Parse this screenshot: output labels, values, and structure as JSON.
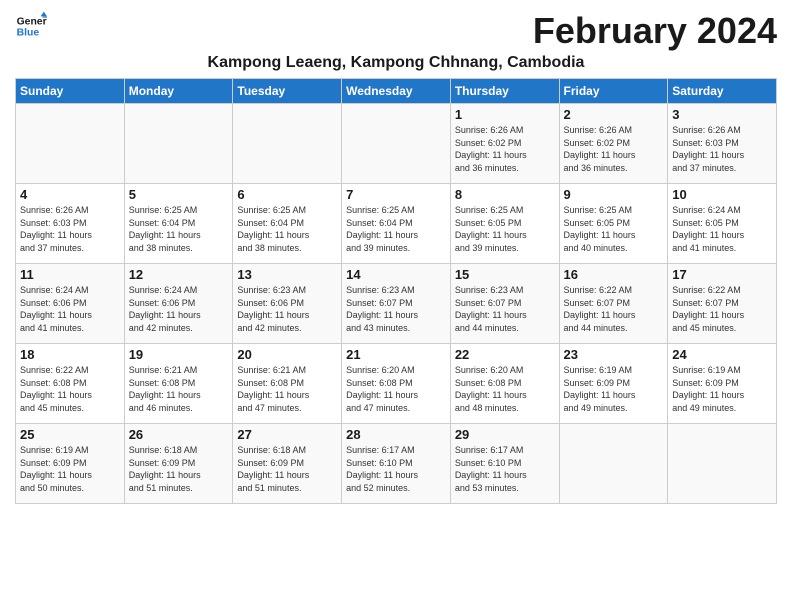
{
  "app": {
    "name": "GeneralBlue",
    "logo_text_line1": "General",
    "logo_text_line2": "Blue"
  },
  "calendar": {
    "month_year": "February 2024",
    "location": "Kampong Leaeng, Kampong Chhnang, Cambodia",
    "days_of_week": [
      "Sunday",
      "Monday",
      "Tuesday",
      "Wednesday",
      "Thursday",
      "Friday",
      "Saturday"
    ],
    "weeks": [
      [
        {
          "day": "",
          "info": ""
        },
        {
          "day": "",
          "info": ""
        },
        {
          "day": "",
          "info": ""
        },
        {
          "day": "",
          "info": ""
        },
        {
          "day": "1",
          "info": "Sunrise: 6:26 AM\nSunset: 6:02 PM\nDaylight: 11 hours\nand 36 minutes."
        },
        {
          "day": "2",
          "info": "Sunrise: 6:26 AM\nSunset: 6:02 PM\nDaylight: 11 hours\nand 36 minutes."
        },
        {
          "day": "3",
          "info": "Sunrise: 6:26 AM\nSunset: 6:03 PM\nDaylight: 11 hours\nand 37 minutes."
        }
      ],
      [
        {
          "day": "4",
          "info": "Sunrise: 6:26 AM\nSunset: 6:03 PM\nDaylight: 11 hours\nand 37 minutes."
        },
        {
          "day": "5",
          "info": "Sunrise: 6:25 AM\nSunset: 6:04 PM\nDaylight: 11 hours\nand 38 minutes."
        },
        {
          "day": "6",
          "info": "Sunrise: 6:25 AM\nSunset: 6:04 PM\nDaylight: 11 hours\nand 38 minutes."
        },
        {
          "day": "7",
          "info": "Sunrise: 6:25 AM\nSunset: 6:04 PM\nDaylight: 11 hours\nand 39 minutes."
        },
        {
          "day": "8",
          "info": "Sunrise: 6:25 AM\nSunset: 6:05 PM\nDaylight: 11 hours\nand 39 minutes."
        },
        {
          "day": "9",
          "info": "Sunrise: 6:25 AM\nSunset: 6:05 PM\nDaylight: 11 hours\nand 40 minutes."
        },
        {
          "day": "10",
          "info": "Sunrise: 6:24 AM\nSunset: 6:05 PM\nDaylight: 11 hours\nand 41 minutes."
        }
      ],
      [
        {
          "day": "11",
          "info": "Sunrise: 6:24 AM\nSunset: 6:06 PM\nDaylight: 11 hours\nand 41 minutes."
        },
        {
          "day": "12",
          "info": "Sunrise: 6:24 AM\nSunset: 6:06 PM\nDaylight: 11 hours\nand 42 minutes."
        },
        {
          "day": "13",
          "info": "Sunrise: 6:23 AM\nSunset: 6:06 PM\nDaylight: 11 hours\nand 42 minutes."
        },
        {
          "day": "14",
          "info": "Sunrise: 6:23 AM\nSunset: 6:07 PM\nDaylight: 11 hours\nand 43 minutes."
        },
        {
          "day": "15",
          "info": "Sunrise: 6:23 AM\nSunset: 6:07 PM\nDaylight: 11 hours\nand 44 minutes."
        },
        {
          "day": "16",
          "info": "Sunrise: 6:22 AM\nSunset: 6:07 PM\nDaylight: 11 hours\nand 44 minutes."
        },
        {
          "day": "17",
          "info": "Sunrise: 6:22 AM\nSunset: 6:07 PM\nDaylight: 11 hours\nand 45 minutes."
        }
      ],
      [
        {
          "day": "18",
          "info": "Sunrise: 6:22 AM\nSunset: 6:08 PM\nDaylight: 11 hours\nand 45 minutes."
        },
        {
          "day": "19",
          "info": "Sunrise: 6:21 AM\nSunset: 6:08 PM\nDaylight: 11 hours\nand 46 minutes."
        },
        {
          "day": "20",
          "info": "Sunrise: 6:21 AM\nSunset: 6:08 PM\nDaylight: 11 hours\nand 47 minutes."
        },
        {
          "day": "21",
          "info": "Sunrise: 6:20 AM\nSunset: 6:08 PM\nDaylight: 11 hours\nand 47 minutes."
        },
        {
          "day": "22",
          "info": "Sunrise: 6:20 AM\nSunset: 6:08 PM\nDaylight: 11 hours\nand 48 minutes."
        },
        {
          "day": "23",
          "info": "Sunrise: 6:19 AM\nSunset: 6:09 PM\nDaylight: 11 hours\nand 49 minutes."
        },
        {
          "day": "24",
          "info": "Sunrise: 6:19 AM\nSunset: 6:09 PM\nDaylight: 11 hours\nand 49 minutes."
        }
      ],
      [
        {
          "day": "25",
          "info": "Sunrise: 6:19 AM\nSunset: 6:09 PM\nDaylight: 11 hours\nand 50 minutes."
        },
        {
          "day": "26",
          "info": "Sunrise: 6:18 AM\nSunset: 6:09 PM\nDaylight: 11 hours\nand 51 minutes."
        },
        {
          "day": "27",
          "info": "Sunrise: 6:18 AM\nSunset: 6:09 PM\nDaylight: 11 hours\nand 51 minutes."
        },
        {
          "day": "28",
          "info": "Sunrise: 6:17 AM\nSunset: 6:10 PM\nDaylight: 11 hours\nand 52 minutes."
        },
        {
          "day": "29",
          "info": "Sunrise: 6:17 AM\nSunset: 6:10 PM\nDaylight: 11 hours\nand 53 minutes."
        },
        {
          "day": "",
          "info": ""
        },
        {
          "day": "",
          "info": ""
        }
      ]
    ]
  }
}
